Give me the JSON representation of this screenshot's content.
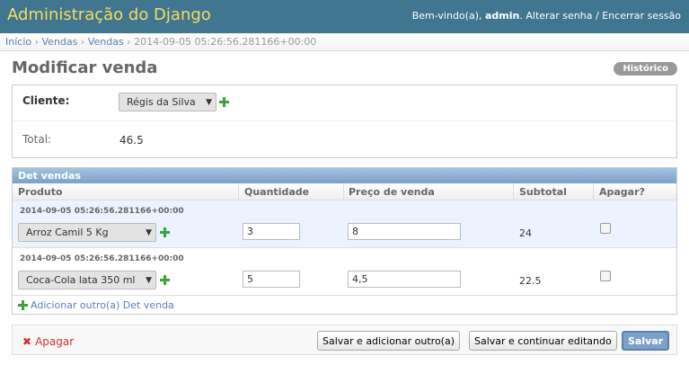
{
  "header": {
    "site_title": "Administração do Django",
    "welcome_prefix": "Bem-vindo(a),",
    "username": "admin",
    "change_password": "Alterar senha",
    "separator": "/",
    "logout": "Encerrar sessão"
  },
  "breadcrumbs": {
    "home": "Início",
    "app": "Vendas",
    "model": "Vendas",
    "current": "2014-09-05 05:26:56.281166+00:00",
    "sep": "›"
  },
  "page": {
    "title": "Modificar venda",
    "history": "Histórico"
  },
  "form": {
    "cliente_label": "Cliente:",
    "cliente_value": "Régis da Silva",
    "total_label": "Total:",
    "total_value": "46.5"
  },
  "inline": {
    "caption": "Det vendas",
    "columns": [
      "Produto",
      "Quantidade",
      "Preço de venda",
      "Subtotal",
      "Apagar?"
    ],
    "rows": [
      {
        "original": "2014-09-05 05:26:56.281166+00:00",
        "produto": "Arroz Camil 5 Kg",
        "quantidade": "3",
        "preco": "8",
        "subtotal": "24"
      },
      {
        "original": "2014-09-05 05:26:56.281166+00:00",
        "produto": "Coca-Cola lata 350 ml",
        "quantidade": "5",
        "preco": "4,5",
        "subtotal": "22.5"
      }
    ],
    "add_another": "Adicionar outro(a) Det venda"
  },
  "submit": {
    "delete": "Apagar",
    "save_add": "Salvar e adicionar outro(a)",
    "save_continue": "Salvar e continuar editando",
    "save": "Salvar"
  },
  "colors": {
    "header_bg": "#417690",
    "site_title": "#f5dd5d",
    "link": "#5b80b2",
    "add_green": "#3ca23c",
    "delete_red": "#cc3333",
    "inline_caption": "#7ca0c7"
  },
  "icons": {
    "add": "plus-icon",
    "delete": "x-icon",
    "dropdown": "triangle-down-icon"
  }
}
